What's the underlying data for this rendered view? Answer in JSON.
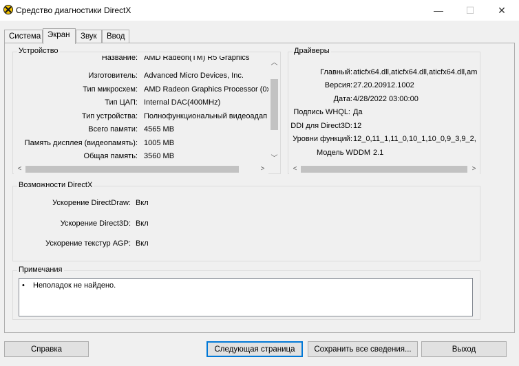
{
  "window": {
    "title": "Средство диагностики DirectX",
    "minimize_glyph": "—",
    "maximize_glyph": "☐",
    "close_glyph": "✕"
  },
  "tabs": [
    {
      "label": "Система"
    },
    {
      "label": "Экран"
    },
    {
      "label": "Звук"
    },
    {
      "label": "Ввод"
    }
  ],
  "device": {
    "title": "Устройство",
    "rows": [
      {
        "key": "Название:",
        "value": "AMD Radeon(TM) R5 Graphics"
      },
      {
        "key": "Изготовитель:",
        "value": "Advanced Micro Devices, Inc."
      },
      {
        "key": "Тип микросхем:",
        "value": "AMD Radeon Graphics Processor (0x9"
      },
      {
        "key": "Тип ЦАП:",
        "value": "Internal DAC(400MHz)"
      },
      {
        "key": "Тип устройства:",
        "value": "Полнофункциональный видеоадап"
      },
      {
        "key": "Всего памяти:",
        "value": "4565 MB"
      },
      {
        "key": "Память дисплея (видеопамять):",
        "value": "1005 MB"
      },
      {
        "key": "Общая память:",
        "value": "3560 MB"
      }
    ]
  },
  "drivers": {
    "title": "Драйверы",
    "rows": [
      {
        "key": "Главный:",
        "value": "aticfx64.dll,aticfx64.dll,aticfx64.dll,am"
      },
      {
        "key": "Версия:",
        "value": "27.20.20912.1002"
      },
      {
        "key": "Дата:",
        "value": "4/28/2022 03:00:00"
      },
      {
        "key": "Подпись WHQL:",
        "value": "Да"
      },
      {
        "key": "DDI для Direct3D:",
        "value": "12"
      },
      {
        "key": "Уровни функций:",
        "value": "12_0,11_1,11_0,10_1,10_0,9_3,9_2,"
      },
      {
        "key": "Модель WDDM",
        "value": "2.1"
      }
    ]
  },
  "features": {
    "title": "Возможности DirectX",
    "rows": [
      {
        "key": "Ускорение DirectDraw:",
        "value": "Вкл"
      },
      {
        "key": "Ускорение Direct3D:",
        "value": "Вкл"
      },
      {
        "key": "Ускорение текстур AGP:",
        "value": "Вкл"
      }
    ]
  },
  "notes": {
    "title": "Примечания",
    "items": [
      "Неполадок не найдено."
    ]
  },
  "buttons": {
    "help": "Справка",
    "next_page": "Следующая страница",
    "save_all": "Сохранить все сведения...",
    "exit": "Выход"
  },
  "colors": {
    "accent": "#0078d7",
    "icon_yellow": "#f5c400",
    "icon_dark": "#1a1a1a"
  }
}
